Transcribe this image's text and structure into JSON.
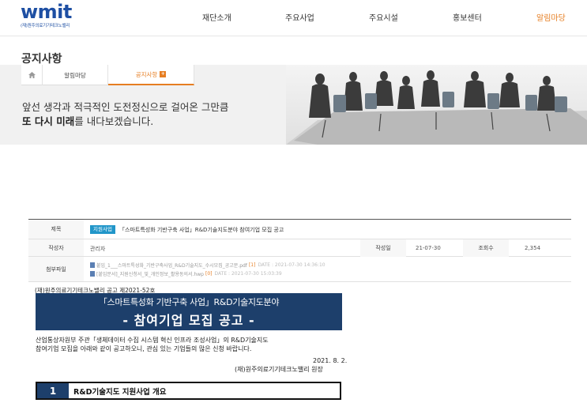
{
  "header": {
    "logo": "wmit",
    "logo_sub": "(재)원주의료기기테크노밸리",
    "nav": [
      "재단소개",
      "주요사업",
      "주요시설",
      "홍보센터",
      "알림마당"
    ]
  },
  "page_title": "공지사항",
  "tabs": {
    "home_icon": "home-icon",
    "items": [
      "알림마당",
      "공지사항"
    ],
    "active_badge": "+"
  },
  "banner": {
    "line1": "앞선 생각과 적극적인 도전정신으로 걸어온 그만큼",
    "line2_bold": "또 다시 미래",
    "line2_rest": "를 내다보겠습니다."
  },
  "post": {
    "labels": {
      "title": "제목",
      "author": "작성자",
      "date": "작성일",
      "views": "조회수",
      "files": "첨부파일"
    },
    "category": "지원사업",
    "title": "「스마트특성화 기반구축 사업」R&D기술지도분야 참여기업 모집 공고",
    "author": "관리자",
    "date": "21-07-30",
    "views": "2,354",
    "files": [
      {
        "name": "붙임_1___스마트특성화_기반구축사업_R&D기술지도_수시모집_공고문.pdf",
        "size": "[1]",
        "date": "DATE : 2021-07-30 14:36:10"
      },
      {
        "name": "[붙임문서]_지원신청서_및_개인정보_활용동의서.hwp",
        "size": "[0]",
        "date": "DATE : 2021-07-30 15:03:39"
      }
    ]
  },
  "announcement": {
    "doc_no": "(재)원주의료기기테크노밸리 공고 제2021-52호",
    "headline1": "「스마트특성화 기반구축 사업」R&D기술지도분야",
    "headline2": "- 참여기업 모집 공고 -",
    "intro1": "산업통상자원부 주관「생체데이터 수집 시스템 혁신 인프라 조성사업」의 R&D기술지도",
    "intro2": "참여기업 모집을 아래와 같이 공고하오니, 관심 있는 기업들의 많은 신청 바랍니다.",
    "date": "2021. 8. 2.",
    "signer": "(재)원주의료기기테크노밸리 원장",
    "section_num": "1",
    "section_title": "R&D기술지도 지원사업 개요"
  },
  "colors": {
    "brand": "#1e4fa3",
    "accent": "#e67e22",
    "navy": "#1d3f6b",
    "badge": "#2196c9"
  }
}
